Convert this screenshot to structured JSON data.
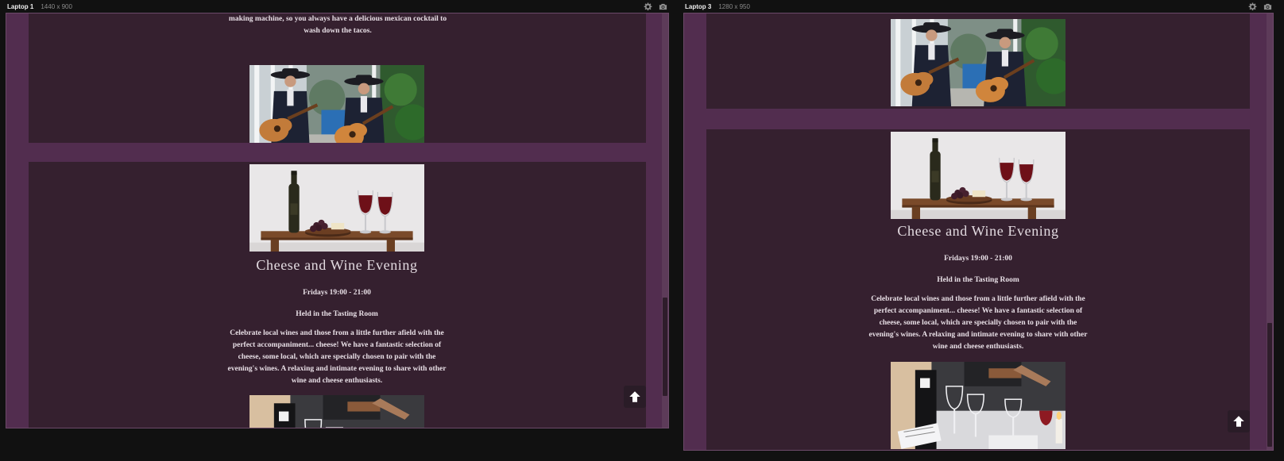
{
  "devices": [
    {
      "name": "Laptop 1",
      "size": "1440 x 900",
      "top_text": "nachos. The Cafe transforms to a Margharita and Mexican Mule making machine, so you always have a delicious mexican cocktail to wash down the tacos."
    },
    {
      "name": "Laptop 3",
      "size": "1280 x 950"
    }
  ],
  "event": {
    "title": "Cheese and Wine Evening",
    "schedule": "Fridays 19:00 - 21:00",
    "location": "Held in the Tasting Room",
    "description": "Celebrate local wines and those from a little further afield with the perfect accompaniment... cheese! We have a fantastic selection of cheese, some local, which are specially chosen to pair with the evening's wines. A relaxing and intimate evening to share with other wine and cheese enthusiasts."
  },
  "icons": {
    "settings": "gear-icon",
    "screenshot": "camera-icon",
    "scroll_top": "arrow-up-icon"
  },
  "colors": {
    "page_background": "#522d4f",
    "card_background": "#35202f",
    "text": "#e8dfe6",
    "chrome_background": "#111111"
  }
}
